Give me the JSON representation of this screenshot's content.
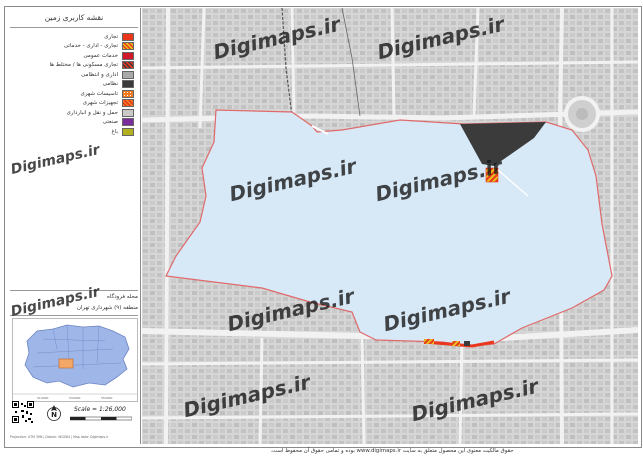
{
  "legend": {
    "title": "نقشه کاربری زمین",
    "items": [
      {
        "label": "تجاری",
        "color": "#e8371d",
        "pattern": "solid"
      },
      {
        "label": "تجاری - اداری - خدماتی",
        "color": "#e8c01d",
        "pattern": "hatch-red"
      },
      {
        "label": "خدمات عمومی",
        "color": "#d01a2a",
        "pattern": "solid"
      },
      {
        "label": "تجاری مسکونی ها / مختلط ها",
        "color": "#e8371d",
        "pattern": "hatch-dark"
      },
      {
        "label": "اداری و انتظامی",
        "color": "#a8a8a8",
        "pattern": "solid"
      },
      {
        "label": "نظامی",
        "color": "#3b3b3b",
        "pattern": "solid"
      },
      {
        "label": "تاسیسات شهری",
        "color": "#f07a20",
        "pattern": "dots"
      },
      {
        "label": "تجهیزات شهری",
        "color": "#f07a20",
        "pattern": "cross"
      },
      {
        "label": "حمل و نقل و انبارداری",
        "color": "#c9c9c9",
        "pattern": "solid"
      },
      {
        "label": "صنعتی",
        "color": "#7a2a9a",
        "pattern": "solid"
      },
      {
        "label": "باغ",
        "color": "#b0b020",
        "pattern": "solid"
      }
    ]
  },
  "area": {
    "name": "محله فرودگاه",
    "district": "منطقه (۹) شهرداری تهران"
  },
  "minimap": {
    "ticks_x": [
      "510000",
      "530000",
      "550000"
    ]
  },
  "scale": {
    "text": "Scale = 1:26,000"
  },
  "north_label": "N",
  "footer_small": "Projection: UTM 39N | Datum: WGS84 | Map data: Digimaps.ir",
  "watermark": "Digimaps.ir",
  "copyright": "حقوق مالکیت معنوی این محصول متعلق به سایت www.digimaps.ir بوده و تمامی حقوق آن محفوظ است.",
  "colors": {
    "study_area_fill": "#d7e8f7",
    "study_area_border": "#e06a6a",
    "military": "#3b3b3b",
    "map_background": "#d9d9d9",
    "city_polygon": "#9fb6e8"
  }
}
